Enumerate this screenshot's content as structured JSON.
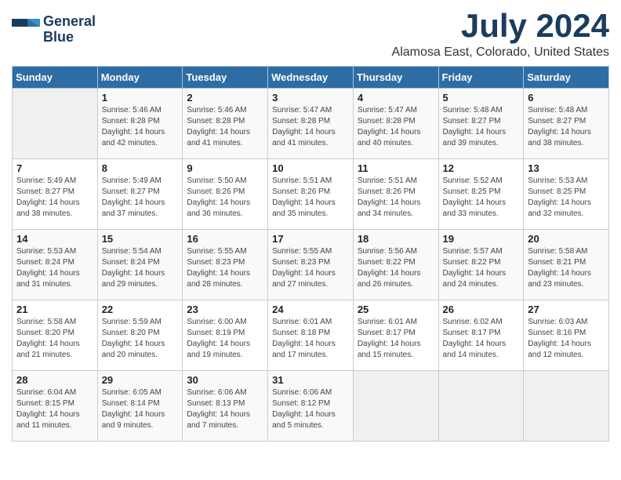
{
  "logo": {
    "line1": "General",
    "line2": "Blue"
  },
  "title": "July 2024",
  "location": "Alamosa East, Colorado, United States",
  "days_of_week": [
    "Sunday",
    "Monday",
    "Tuesday",
    "Wednesday",
    "Thursday",
    "Friday",
    "Saturday"
  ],
  "weeks": [
    [
      {
        "day": "",
        "empty": true
      },
      {
        "day": "1",
        "sunrise": "Sunrise: 5:46 AM",
        "sunset": "Sunset: 8:28 PM",
        "daylight": "Daylight: 14 hours and 42 minutes."
      },
      {
        "day": "2",
        "sunrise": "Sunrise: 5:46 AM",
        "sunset": "Sunset: 8:28 PM",
        "daylight": "Daylight: 14 hours and 41 minutes."
      },
      {
        "day": "3",
        "sunrise": "Sunrise: 5:47 AM",
        "sunset": "Sunset: 8:28 PM",
        "daylight": "Daylight: 14 hours and 41 minutes."
      },
      {
        "day": "4",
        "sunrise": "Sunrise: 5:47 AM",
        "sunset": "Sunset: 8:28 PM",
        "daylight": "Daylight: 14 hours and 40 minutes."
      },
      {
        "day": "5",
        "sunrise": "Sunrise: 5:48 AM",
        "sunset": "Sunset: 8:27 PM",
        "daylight": "Daylight: 14 hours and 39 minutes."
      },
      {
        "day": "6",
        "sunrise": "Sunrise: 5:48 AM",
        "sunset": "Sunset: 8:27 PM",
        "daylight": "Daylight: 14 hours and 38 minutes."
      }
    ],
    [
      {
        "day": "7",
        "sunrise": "Sunrise: 5:49 AM",
        "sunset": "Sunset: 8:27 PM",
        "daylight": "Daylight: 14 hours and 38 minutes."
      },
      {
        "day": "8",
        "sunrise": "Sunrise: 5:49 AM",
        "sunset": "Sunset: 8:27 PM",
        "daylight": "Daylight: 14 hours and 37 minutes."
      },
      {
        "day": "9",
        "sunrise": "Sunrise: 5:50 AM",
        "sunset": "Sunset: 8:26 PM",
        "daylight": "Daylight: 14 hours and 36 minutes."
      },
      {
        "day": "10",
        "sunrise": "Sunrise: 5:51 AM",
        "sunset": "Sunset: 8:26 PM",
        "daylight": "Daylight: 14 hours and 35 minutes."
      },
      {
        "day": "11",
        "sunrise": "Sunrise: 5:51 AM",
        "sunset": "Sunset: 8:26 PM",
        "daylight": "Daylight: 14 hours and 34 minutes."
      },
      {
        "day": "12",
        "sunrise": "Sunrise: 5:52 AM",
        "sunset": "Sunset: 8:25 PM",
        "daylight": "Daylight: 14 hours and 33 minutes."
      },
      {
        "day": "13",
        "sunrise": "Sunrise: 5:53 AM",
        "sunset": "Sunset: 8:25 PM",
        "daylight": "Daylight: 14 hours and 32 minutes."
      }
    ],
    [
      {
        "day": "14",
        "sunrise": "Sunrise: 5:53 AM",
        "sunset": "Sunset: 8:24 PM",
        "daylight": "Daylight: 14 hours and 31 minutes."
      },
      {
        "day": "15",
        "sunrise": "Sunrise: 5:54 AM",
        "sunset": "Sunset: 8:24 PM",
        "daylight": "Daylight: 14 hours and 29 minutes."
      },
      {
        "day": "16",
        "sunrise": "Sunrise: 5:55 AM",
        "sunset": "Sunset: 8:23 PM",
        "daylight": "Daylight: 14 hours and 28 minutes."
      },
      {
        "day": "17",
        "sunrise": "Sunrise: 5:55 AM",
        "sunset": "Sunset: 8:23 PM",
        "daylight": "Daylight: 14 hours and 27 minutes."
      },
      {
        "day": "18",
        "sunrise": "Sunrise: 5:56 AM",
        "sunset": "Sunset: 8:22 PM",
        "daylight": "Daylight: 14 hours and 26 minutes."
      },
      {
        "day": "19",
        "sunrise": "Sunrise: 5:57 AM",
        "sunset": "Sunset: 8:22 PM",
        "daylight": "Daylight: 14 hours and 24 minutes."
      },
      {
        "day": "20",
        "sunrise": "Sunrise: 5:58 AM",
        "sunset": "Sunset: 8:21 PM",
        "daylight": "Daylight: 14 hours and 23 minutes."
      }
    ],
    [
      {
        "day": "21",
        "sunrise": "Sunrise: 5:58 AM",
        "sunset": "Sunset: 8:20 PM",
        "daylight": "Daylight: 14 hours and 21 minutes."
      },
      {
        "day": "22",
        "sunrise": "Sunrise: 5:59 AM",
        "sunset": "Sunset: 8:20 PM",
        "daylight": "Daylight: 14 hours and 20 minutes."
      },
      {
        "day": "23",
        "sunrise": "Sunrise: 6:00 AM",
        "sunset": "Sunset: 8:19 PM",
        "daylight": "Daylight: 14 hours and 19 minutes."
      },
      {
        "day": "24",
        "sunrise": "Sunrise: 6:01 AM",
        "sunset": "Sunset: 8:18 PM",
        "daylight": "Daylight: 14 hours and 17 minutes."
      },
      {
        "day": "25",
        "sunrise": "Sunrise: 6:01 AM",
        "sunset": "Sunset: 8:17 PM",
        "daylight": "Daylight: 14 hours and 15 minutes."
      },
      {
        "day": "26",
        "sunrise": "Sunrise: 6:02 AM",
        "sunset": "Sunset: 8:17 PM",
        "daylight": "Daylight: 14 hours and 14 minutes."
      },
      {
        "day": "27",
        "sunrise": "Sunrise: 6:03 AM",
        "sunset": "Sunset: 8:16 PM",
        "daylight": "Daylight: 14 hours and 12 minutes."
      }
    ],
    [
      {
        "day": "28",
        "sunrise": "Sunrise: 6:04 AM",
        "sunset": "Sunset: 8:15 PM",
        "daylight": "Daylight: 14 hours and 11 minutes."
      },
      {
        "day": "29",
        "sunrise": "Sunrise: 6:05 AM",
        "sunset": "Sunset: 8:14 PM",
        "daylight": "Daylight: 14 hours and 9 minutes."
      },
      {
        "day": "30",
        "sunrise": "Sunrise: 6:06 AM",
        "sunset": "Sunset: 8:13 PM",
        "daylight": "Daylight: 14 hours and 7 minutes."
      },
      {
        "day": "31",
        "sunrise": "Sunrise: 6:06 AM",
        "sunset": "Sunset: 8:12 PM",
        "daylight": "Daylight: 14 hours and 5 minutes."
      },
      {
        "day": "",
        "empty": true
      },
      {
        "day": "",
        "empty": true
      },
      {
        "day": "",
        "empty": true
      }
    ]
  ]
}
